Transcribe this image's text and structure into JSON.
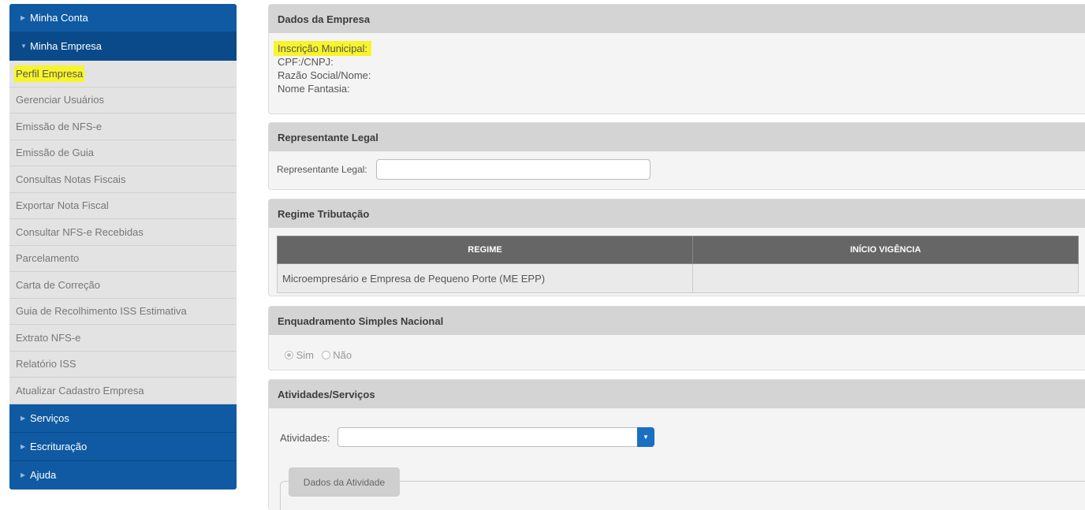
{
  "sidebar": {
    "minha_conta": "Minha Conta",
    "minha_empresa": "Minha Empresa",
    "items": [
      "Perfil Empresa",
      "Gerenciar Usuários",
      "Emissão de NFS-e",
      "Emissão de Guia",
      "Consultas Notas Fiscais",
      "Exportar Nota Fiscal",
      "Consultar NFS-e Recebidas",
      "Parcelamento",
      "Carta de Correção",
      "Guia de Recolhimento ISS Estimativa",
      "Extrato NFS-e",
      "Relatório ISS",
      "Atualizar Cadastro Empresa"
    ],
    "servicos": "Serviços",
    "escrituracao": "Escrituração",
    "ajuda": "Ajuda"
  },
  "dados_empresa": {
    "title": "Dados da Empresa",
    "inscricao": "Inscrição Municipal:",
    "cpf": "CPF:/CNPJ:",
    "razao": "Razão Social/Nome:",
    "fantasia": "Nome Fantasia:"
  },
  "representante": {
    "title": "Representante Legal",
    "label": "Representante Legal:",
    "value": ""
  },
  "regime": {
    "title": "Regime Tributação",
    "col_regime": "REGIME",
    "col_inicio": "INÍCIO VIGÊNCIA",
    "row_regime": "Microempresário e Empresa de Pequeno Porte (ME EPP)",
    "row_inicio": ""
  },
  "simples": {
    "title": "Enquadramento Simples Nacional",
    "sim": "Sim",
    "nao": "Não",
    "selected": "Sim"
  },
  "atividades": {
    "title": "Atividades/Serviços",
    "label": "Atividades:",
    "value": "",
    "legend": "Dados da Atividade"
  },
  "colors": {
    "nav_blue": "#0f5aa3",
    "highlight": "#f7f42c",
    "table_head": "#666666"
  }
}
